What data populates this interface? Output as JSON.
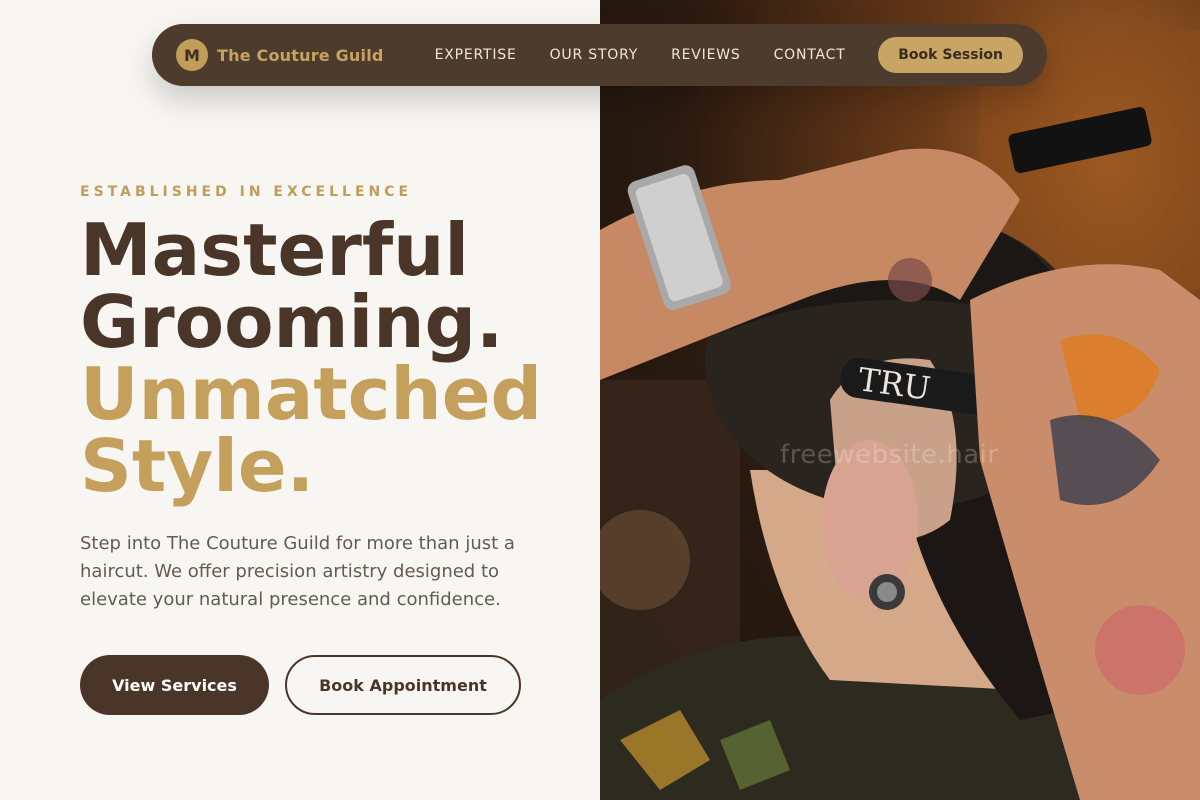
{
  "brand": {
    "mark": "M",
    "name": "The Couture Guild"
  },
  "nav": {
    "items": [
      "EXPERTISE",
      "OUR STORY",
      "REVIEWS",
      "CONTACT"
    ],
    "cta": "Book Session"
  },
  "hero": {
    "eyebrow": "ESTABLISHED IN EXCELLENCE",
    "headline_line1": "Masterful",
    "headline_line2": "Grooming.",
    "headline_line3": "Unmatched",
    "headline_line4": "Style.",
    "lead": "Step into The Couture Guild for more than just a haircut. We offer precision artistry designed to elevate your natural presence and confidence.",
    "primary_button": "View Services",
    "secondary_button": "Book Appointment"
  },
  "photo": {
    "razor_text": "TRU",
    "watermark": "freewebsite.hair"
  },
  "colors": {
    "background": "#f8f6f2",
    "brown": "#4a3628",
    "gold": "#c4a05c",
    "nav": "#4d3b2e"
  }
}
